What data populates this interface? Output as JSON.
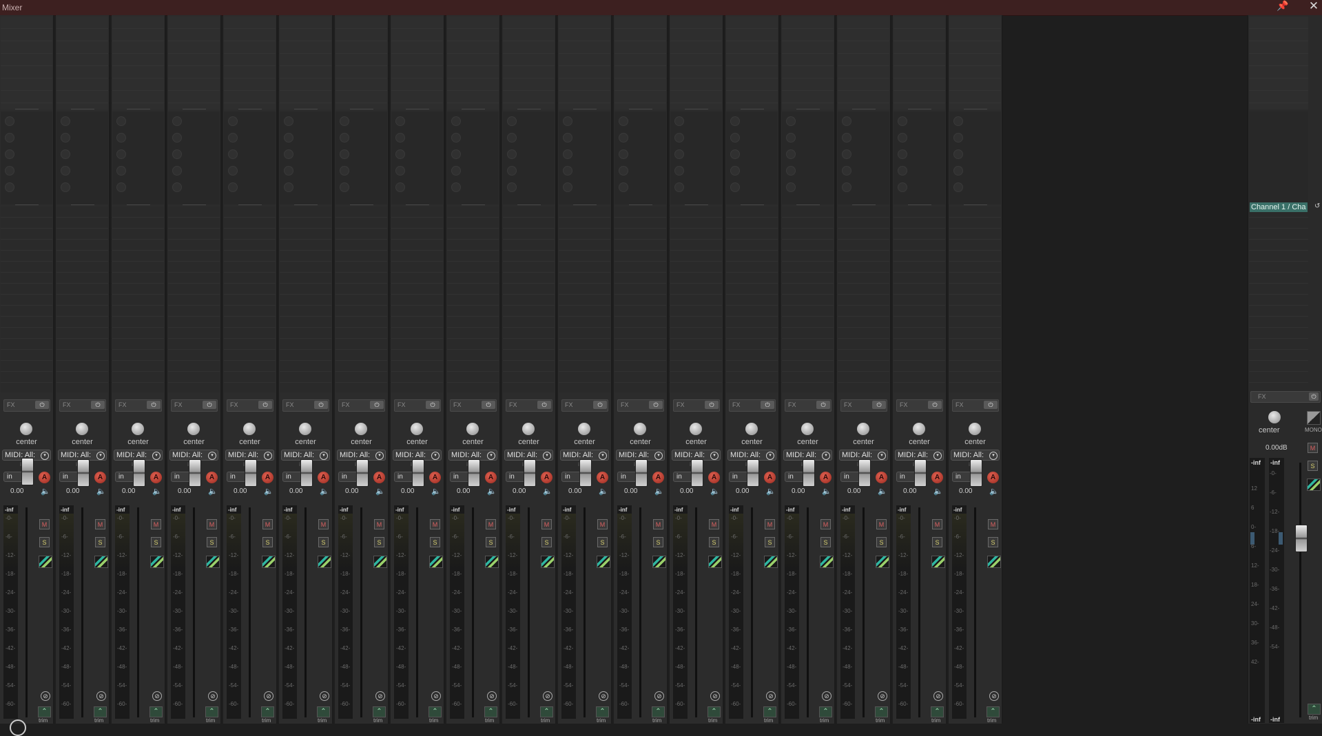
{
  "window": {
    "title": "Mixer",
    "pin_icon": "pin-icon",
    "close_icon": "close-icon"
  },
  "strip_template": {
    "fx_label": "FX",
    "power_icon": "power-icon",
    "pan_label": "center",
    "midi_input": "MIDI: All:",
    "infx_label": "in FX",
    "input_mode": "in",
    "arm_label": "A",
    "volume": "0.00",
    "meter_peak": "-inf",
    "mute_label": "M",
    "solo_label": "S",
    "phase_icon": "phase-invert-icon",
    "trim_label": "trim",
    "meter_ticks": [
      "-0-",
      "-6-",
      "-12-",
      "-18-",
      "-24-",
      "-30-",
      "-36-",
      "-42-",
      "-48-",
      "-54-",
      "-60-"
    ]
  },
  "strip_count": 18,
  "master": {
    "channel_label": "Channel 1 / Cha",
    "fx_label": "FX",
    "pan_label": "center",
    "mono_label": "MONO",
    "volume": "0.00dB",
    "meter_peak_left": "-inf",
    "meter_peak_right": "-inf",
    "mute_label": "M",
    "solo_label": "S",
    "trim_label": "trim",
    "left_ticks": [
      "12",
      "6",
      "0-",
      "6-",
      "12-",
      "18-",
      "24-",
      "30-",
      "36-",
      "42-"
    ],
    "right_ticks": [
      "-0-",
      "-6-",
      "-12-",
      "-18-",
      "-24-",
      "-30-",
      "-36-",
      "-42-",
      "-48-",
      "-54-"
    ],
    "right_scale": [
      "12",
      "6",
      "-6",
      "-12",
      "-18",
      "-24",
      "-30",
      "-36",
      "-42"
    ]
  },
  "colors": {
    "titlebar": "#3d2020",
    "arm": "#c04030",
    "channel_label_bg": "#3a7068",
    "automation": "#2fb6a0"
  }
}
